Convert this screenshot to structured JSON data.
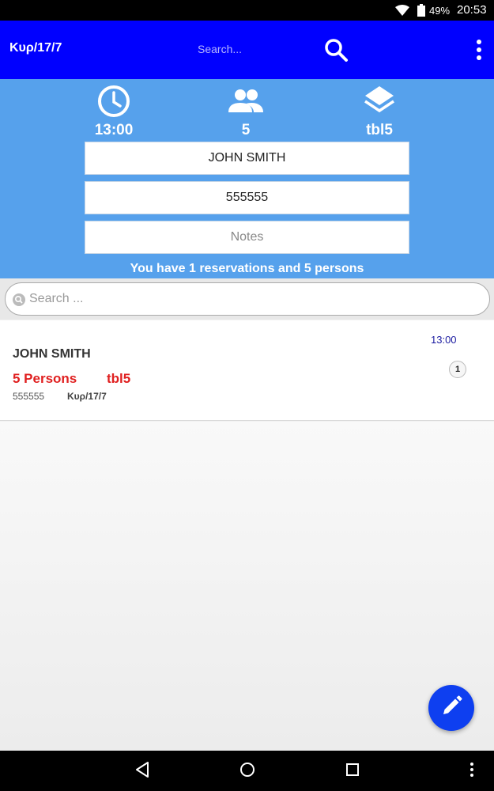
{
  "status_bar": {
    "battery": "49%",
    "time": "20:53"
  },
  "app_bar": {
    "title": "Κυρ/17/7",
    "search_placeholder": "Search..."
  },
  "header": {
    "time": "13:00",
    "persons": "5",
    "table": "tbl5",
    "name": "JOHN SMITH",
    "phone": "555555",
    "notes_placeholder": "Notes",
    "summary": "You have 1 reservations and 5 persons"
  },
  "list_search": {
    "placeholder": "Search ..."
  },
  "reservations": [
    {
      "name": "JOHN SMITH",
      "persons": "5 Persons",
      "table": "tbl5",
      "phone": "555555",
      "date": "Κυρ/17/7",
      "time": "13:00",
      "count": "1"
    }
  ],
  "colors": {
    "app_bar": "#0000ff",
    "header": "#56a1ec",
    "accent_red": "#e02020",
    "fab": "#0e3ff0"
  },
  "icons": [
    "wifi-icon",
    "battery-icon",
    "search-icon",
    "more-vert-icon",
    "clock-icon",
    "people-icon",
    "layers-icon",
    "pencil-icon",
    "back-icon",
    "home-icon",
    "recents-icon"
  ]
}
